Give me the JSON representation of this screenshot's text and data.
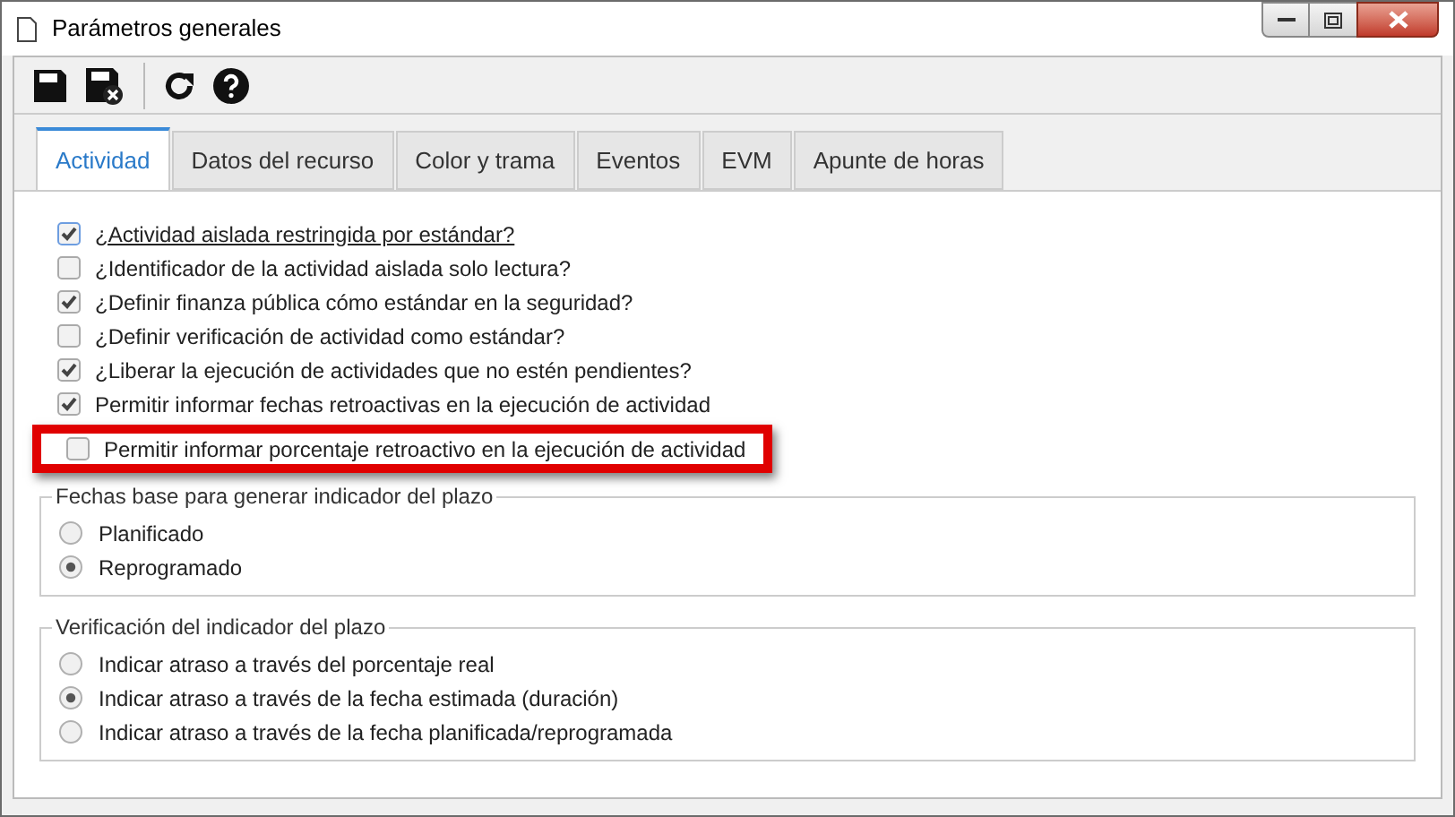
{
  "window": {
    "title": "Parámetros generales"
  },
  "tabs": [
    {
      "label": "Actividad",
      "selected": true
    },
    {
      "label": "Datos del recurso",
      "selected": false
    },
    {
      "label": "Color y trama",
      "selected": false
    },
    {
      "label": "Eventos",
      "selected": false
    },
    {
      "label": "EVM",
      "selected": false
    },
    {
      "label": "Apunte de horas",
      "selected": false
    }
  ],
  "options": [
    {
      "label": "¿Actividad aislada restringida por estándar?",
      "checked": true,
      "focused": true
    },
    {
      "label": "¿Identificador de la actividad aislada solo lectura?",
      "checked": false
    },
    {
      "label": "¿Definir finanza pública cómo estándar en la seguridad?",
      "checked": true
    },
    {
      "label": "¿Definir verificación de actividad como estándar?",
      "checked": false
    },
    {
      "label": "¿Liberar la ejecución de actividades que no estén pendientes?",
      "checked": true
    },
    {
      "label": "Permitir informar fechas retroactivas en la ejecución de actividad",
      "checked": true
    },
    {
      "label": "Permitir informar porcentaje retroactivo en la ejecución de actividad",
      "checked": false,
      "highlighted": true
    }
  ],
  "groups": [
    {
      "title": "Fechas base para generar indicador del plazo",
      "choices": [
        {
          "label": "Planificado",
          "selected": false
        },
        {
          "label": "Reprogramado",
          "selected": true
        }
      ]
    },
    {
      "title": "Verificación del indicador del plazo",
      "choices": [
        {
          "label": "Indicar atraso a través del porcentaje real",
          "selected": false
        },
        {
          "label": "Indicar atraso a través de la fecha estimada (duración)",
          "selected": true
        },
        {
          "label": "Indicar atraso a través de la fecha planificada/reprogramada",
          "selected": false
        }
      ]
    }
  ]
}
